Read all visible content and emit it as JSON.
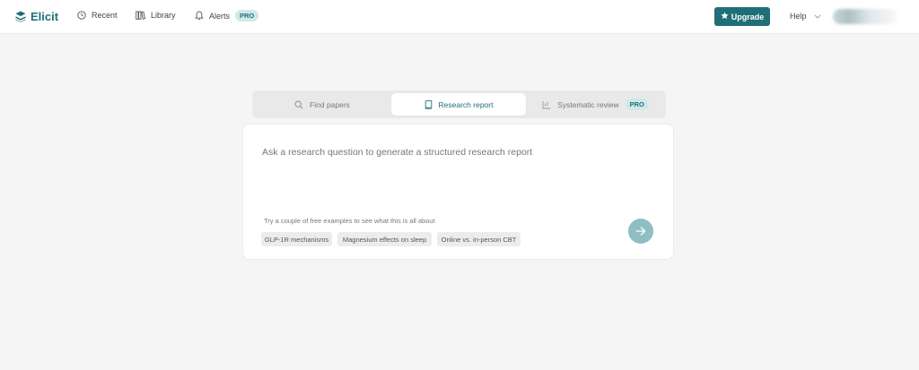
{
  "brand": {
    "name": "Elicit"
  },
  "nav": {
    "recent": "Recent",
    "library": "Library",
    "alerts": "Alerts",
    "pro_badge": "PRO"
  },
  "header": {
    "upgrade_label": "Upgrade",
    "help_label": "Help"
  },
  "modes": {
    "find_papers": "Find papers",
    "research_report": "Research report",
    "systematic_review": "Systematic review",
    "pro_badge": "PRO",
    "active": "research_report"
  },
  "composer": {
    "placeholder": "Ask a research question to generate a structured research report",
    "examples_label": "Try a couple of free examples to see what this is all about",
    "examples": [
      "GLP-1R mechanisms",
      "Magnesium effects on sleep",
      "Online vs. in-person CBT"
    ]
  },
  "colors": {
    "accent": "#1f6f78",
    "submit_disabled": "#8fbec3",
    "page_background": "#f5f5f5"
  },
  "icons": {
    "brand": "elicit-logo-icon",
    "recent": "clock-icon",
    "library": "books-icon",
    "alerts": "bell-icon",
    "upgrade": "star-icon",
    "help": "chevron-down-icon",
    "find_papers": "search-icon",
    "research_report": "book-icon",
    "systematic_review": "review-chart-icon",
    "submit": "arrow-right-icon"
  }
}
